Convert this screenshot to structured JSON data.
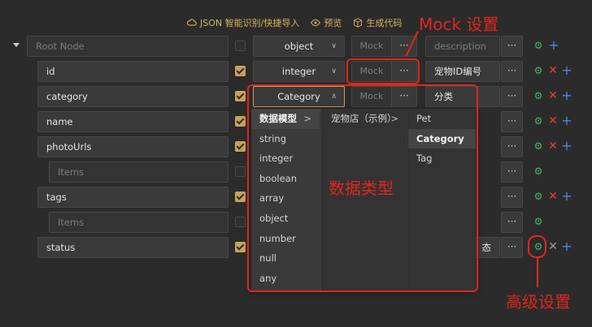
{
  "toolbar": {
    "json_import": "JSON 智能识别/快捷导入",
    "preview": "预览",
    "generate_code": "生成代码"
  },
  "root": {
    "name_placeholder": "Root Node",
    "type": "object",
    "mock_placeholder": "Mock",
    "description_placeholder": "description"
  },
  "rows": [
    {
      "name": "id",
      "type": "integer",
      "mock": "Mock",
      "description": "宠物ID编号"
    },
    {
      "name": "category",
      "type": "Category",
      "mock": "Mock",
      "description": "分类"
    },
    {
      "name": "name"
    },
    {
      "name": "photoUrls"
    },
    {
      "name": "Items"
    },
    {
      "name": "tags"
    },
    {
      "name": "Items"
    },
    {
      "name": "status",
      "description": "态"
    }
  ],
  "cascader": {
    "col1": [
      "数据模型",
      "string",
      "integer",
      "boolean",
      "array",
      "object",
      "number",
      "null",
      "any"
    ],
    "col2": [
      "宠物店（示例）"
    ],
    "col3": [
      "Pet",
      "Category",
      "Tag"
    ]
  },
  "annotations": {
    "mock_settings": "Mock 设置",
    "data_type": "数据类型",
    "advanced_settings": "高级设置"
  },
  "icons": {
    "ellipsis": "···",
    "gear": "⚙",
    "delete": "✕",
    "add": "+",
    "chevron_right": ">",
    "chevron_down": "∨",
    "chevron_up": "∧"
  },
  "colors": {
    "accent": "#c8a258",
    "gear": "#4caf6a",
    "delete": "#e0413a",
    "add": "#4a86e8",
    "annotation": "#e0261c"
  }
}
